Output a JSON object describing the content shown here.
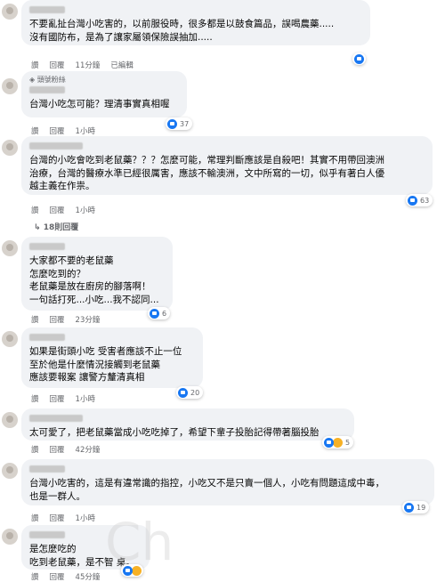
{
  "labels": {
    "like": "讚",
    "reply": "回覆"
  },
  "comments": [
    {
      "lines": [
        "不要亂扯台灣小吃害的，以前服役時，很多都是以鼓食篇品，誤喝農藥.....",
        "沒有國防布，是為了讓家屬領保險誤抽加....."
      ],
      "time": "11分鐘",
      "extra": "已編輯",
      "reactions": ""
    },
    {
      "badge": "頭號粉絲",
      "lines": [
        "台灣小吃怎可能？理清事實真相喔"
      ],
      "time": "1小時",
      "reactions": "37"
    },
    {
      "lines": [
        "台灣的小吃會吃到老鼠藥？？？怎麼可能，常理判斷應該是自殺吧！其實不用帶回澳洲",
        "治療，台灣的醫療水準已經很厲害，應該不輸澳洲，文中所寫的一切，似乎有著白人優",
        "越主義在作祟。"
      ],
      "time": "1小時",
      "reactions": "63",
      "replies": "18則回覆"
    },
    {
      "lines": [
        "大家都不要的老鼠藥",
        "怎麼吃到的？",
        "老鼠藥是放在廚房的腳落啊！",
        "一句話打死...小吃...我不認同..."
      ],
      "time": "23分鐘",
      "reactions": "6"
    },
    {
      "lines": [
        "如果是街頭小吃 受害者應該不止一位",
        "至於他是什麼情況接觸到老鼠藥",
        "應該要報案 讓警方釐清真相"
      ],
      "time": "1小時",
      "reactions": "20"
    },
    {
      "lines": [
        "太可愛了，把老鼠藥當成小吃吃掉了，希望下輩子投胎記得帶著腦投胎"
      ],
      "time": "42分鐘",
      "reactions": "5"
    },
    {
      "lines": [
        "台灣小吃害的，這是有違常識的指控，小吃又不是只賣一個人，小吃有問題這成中毒，",
        "也是一群人。"
      ],
      "time": "1小時",
      "reactions": "19"
    },
    {
      "lines": [
        "是怎麼吃的",
        "吃到老鼠藥，是不智  桌。"
      ],
      "time": "45分鐘",
      "reactions": ""
    }
  ],
  "watermark": "Ch"
}
